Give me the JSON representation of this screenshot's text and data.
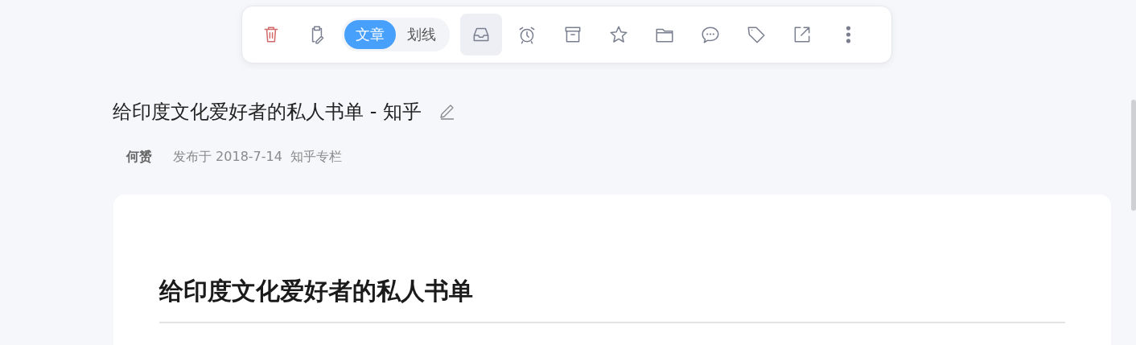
{
  "toolbar": {
    "leading_buttons": [
      {
        "kind": "trash",
        "selected": false
      },
      {
        "kind": "clipboard",
        "selected": false
      }
    ],
    "view_tabs": [
      {
        "label": "文章",
        "selected": true
      },
      {
        "label": "划线",
        "selected": false
      }
    ],
    "buttons": [
      {
        "kind": "inbox",
        "selected": true
      },
      {
        "kind": "alarm",
        "selected": false
      },
      {
        "kind": "archive",
        "selected": false
      },
      {
        "kind": "star",
        "selected": false
      },
      {
        "kind": "folder",
        "selected": false
      },
      {
        "kind": "comment",
        "selected": false
      },
      {
        "kind": "tag",
        "selected": false
      },
      {
        "kind": "share",
        "selected": false
      },
      {
        "kind": "more",
        "selected": false
      }
    ]
  },
  "page_title": "给印度文化爱好者的私人书单 - 知乎",
  "meta": {
    "author": "何赟",
    "published": "发布于 2018-7-14",
    "source": "知乎专栏"
  },
  "article": {
    "heading": "给印度文化爱好者的私人书单"
  }
}
